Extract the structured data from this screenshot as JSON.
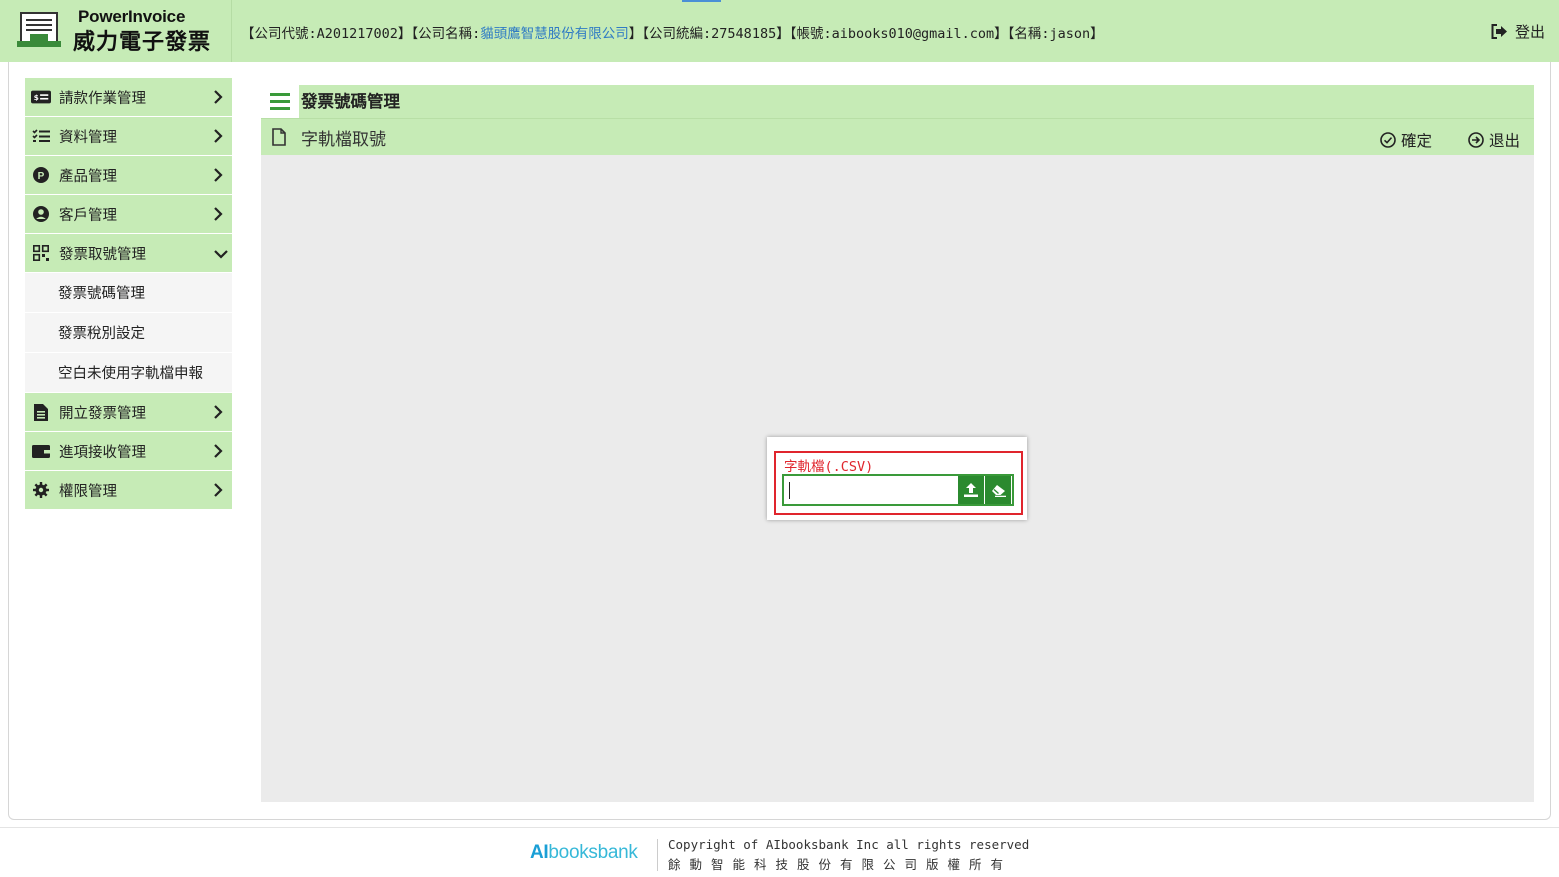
{
  "header": {
    "logo_en": "PowerInvoice",
    "logo_zh": "威力電子發票",
    "info_prefix": "【公司代號:A201217002】【公司名稱:",
    "company_name": "貓頭鷹智慧股份有限公司",
    "info_suffix": "】【公司統編:27548185】【帳號:aibooks010@gmail.com】【名稱:jason】",
    "logout_label": "登出"
  },
  "sidebar": {
    "items": [
      {
        "label": "請款作業管理",
        "icon": "invoice-card-icon"
      },
      {
        "label": "資料管理",
        "icon": "list-icon"
      },
      {
        "label": "產品管理",
        "icon": "product-p-icon"
      },
      {
        "label": "客戶管理",
        "icon": "user-circle-icon"
      },
      {
        "label": "發票取號管理",
        "icon": "qr-grid-icon"
      },
      {
        "label": "開立發票管理",
        "icon": "document-icon"
      },
      {
        "label": "進項接收管理",
        "icon": "wallet-icon"
      },
      {
        "label": "權限管理",
        "icon": "gear-icon"
      }
    ],
    "sub_items": [
      {
        "label": "發票號碼管理"
      },
      {
        "label": "發票稅別設定"
      },
      {
        "label": "空白未使用字軌檔申報"
      }
    ]
  },
  "main": {
    "title": "發票號碼管理",
    "subtitle": "字軌檔取號",
    "confirm_label": "確定",
    "exit_label": "退出"
  },
  "dialog": {
    "label": "字軌檔(.CSV)",
    "file_value": ""
  },
  "footer": {
    "logo_ai": "AI",
    "logo_rest": "booksbank",
    "copyright": "Copyright of AIbooksbank Inc all rights reserved",
    "copyright_zh": "餘動智能科技股份有限公司版權所有"
  },
  "colors": {
    "header_bg": "#c6ebb6",
    "accent_green": "#2b8a2f",
    "highlight_red": "#e0252d",
    "link_blue": "#2f7bc4",
    "content_bg": "#ebebeb"
  }
}
